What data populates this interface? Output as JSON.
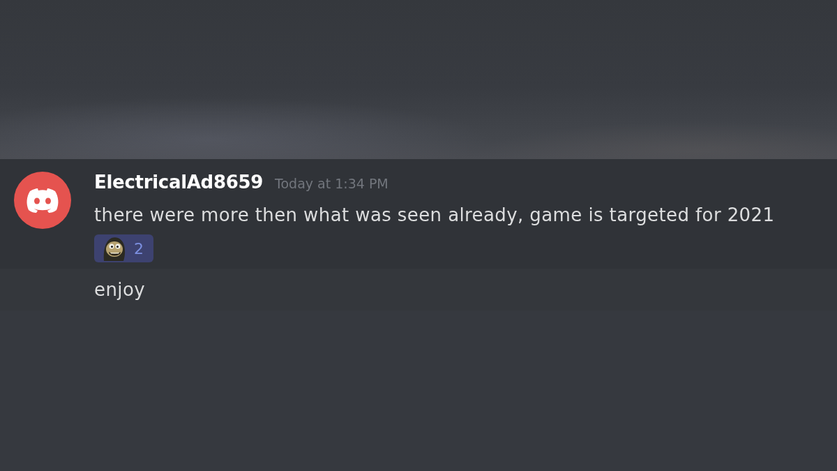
{
  "message_group": {
    "author": "ElectricalAd8659",
    "timestamp": "Today at 1:34 PM",
    "messages": [
      {
        "text": "there were more then what was seen already, game is targeted for 2021",
        "reactions": [
          {
            "count": "2",
            "selected": true
          }
        ]
      },
      {
        "text": "enjoy"
      }
    ]
  }
}
